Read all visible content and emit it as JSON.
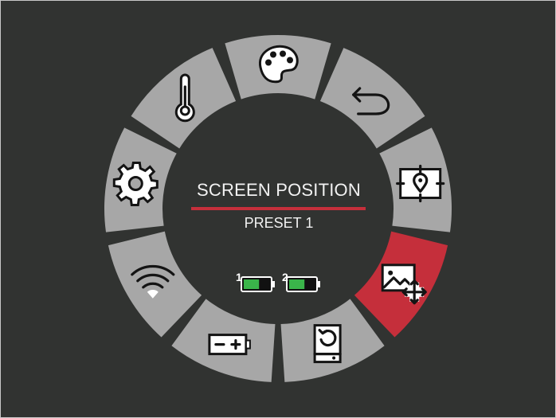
{
  "menu": {
    "title": "SCREEN POSITION",
    "subtitle": "PRESET 1",
    "accent_color": "#c52f3b",
    "segment_color": "#a7a7a7",
    "segments": [
      {
        "id": "palette",
        "icon": "palette-icon",
        "active": false
      },
      {
        "id": "back",
        "icon": "undo-arrow-icon",
        "active": false
      },
      {
        "id": "location",
        "icon": "map-pin-frame-icon",
        "active": false
      },
      {
        "id": "screen-position",
        "icon": "image-move-icon",
        "active": true
      },
      {
        "id": "reset",
        "icon": "device-reset-icon",
        "active": false
      },
      {
        "id": "battery",
        "icon": "battery-charge-icon",
        "active": false
      },
      {
        "id": "wifi",
        "icon": "wifi-icon",
        "active": false
      },
      {
        "id": "settings",
        "icon": "gear-icon",
        "active": false
      },
      {
        "id": "temperature",
        "icon": "thermometer-icon",
        "active": false
      }
    ]
  },
  "batteries": [
    {
      "label": "1",
      "level": 0.6,
      "color": "#3ab54a"
    },
    {
      "label": "2",
      "level": 0.6,
      "color": "#3ab54a"
    }
  ]
}
